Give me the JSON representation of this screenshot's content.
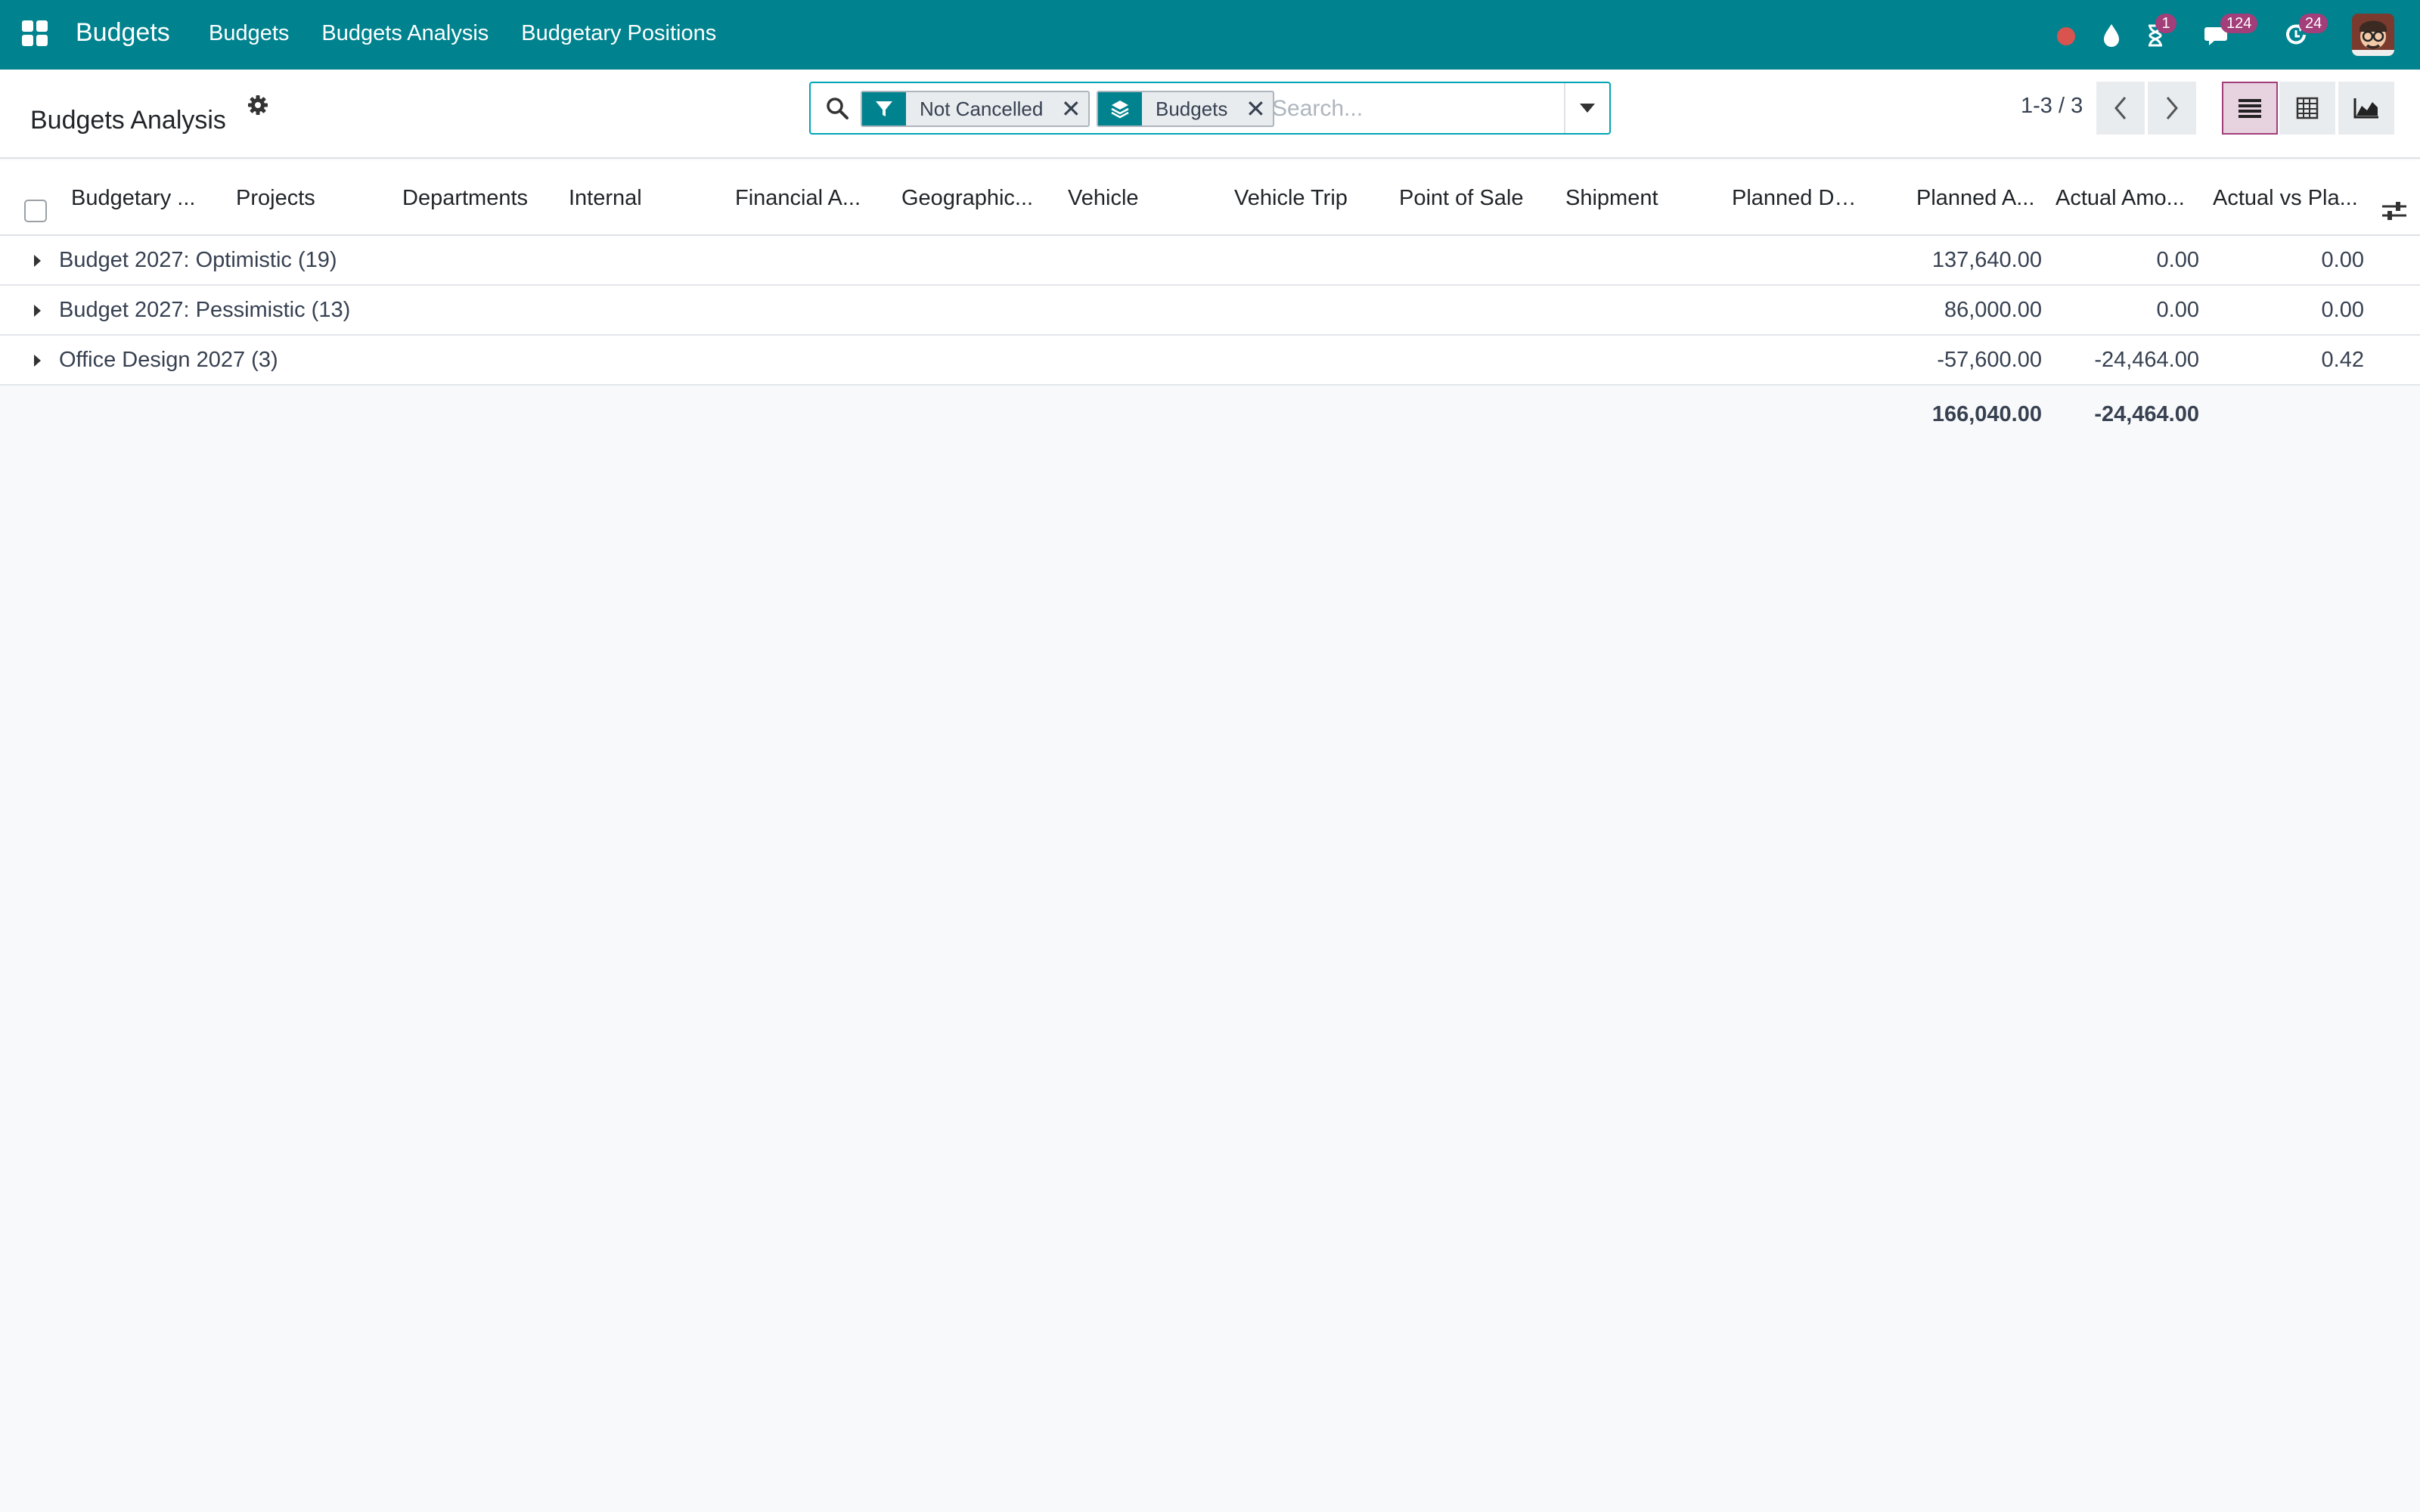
{
  "navbar": {
    "app_name": "Budgets",
    "menu": [
      "Budgets",
      "Budgets Analysis",
      "Budgetary Positions"
    ],
    "activity_count": "1",
    "messages_count": "124",
    "updates_count": "24",
    "background_color": "#00838f",
    "badge_color": "#a23e7a"
  },
  "control_panel": {
    "title": "Budgets Analysis",
    "search": {
      "facets": [
        {
          "type_icon": "filter-icon",
          "label": "Not Cancelled"
        },
        {
          "type_icon": "layers-icon",
          "label": "Budgets"
        }
      ],
      "placeholder": "Search..."
    },
    "pager": "1-3 / 3",
    "views": [
      "list-view-icon",
      "pivot-view-icon",
      "graph-view-icon"
    ],
    "active_view": "list"
  },
  "table": {
    "columns": [
      "Budgetary ...",
      "Projects",
      "Departments",
      "Internal",
      "Financial A...",
      "Geographic...",
      "Vehicle",
      "Vehicle Trip",
      "Point of Sale",
      "Shipment",
      "Planned Da...",
      "Planned A...",
      "Actual Amo...",
      "Actual vs Pla..."
    ],
    "groups": [
      {
        "name": "Budget 2027: Optimistic (19)",
        "planned": "137,640.00",
        "actual": "0.00",
        "ratio": "0.00"
      },
      {
        "name": "Budget 2027: Pessimistic (13)",
        "planned": "86,000.00",
        "actual": "0.00",
        "ratio": "0.00"
      },
      {
        "name": "Office Design 2027 (3)",
        "planned": "-57,600.00",
        "actual": "-24,464.00",
        "ratio": "0.42"
      }
    ],
    "totals": {
      "planned": "166,040.00",
      "actual": "-24,464.00"
    }
  }
}
